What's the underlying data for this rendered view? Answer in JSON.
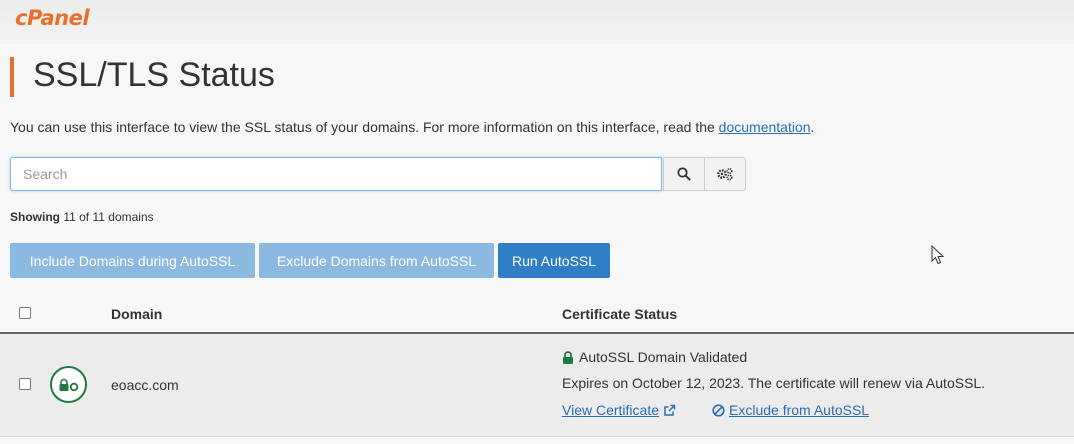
{
  "brand": {
    "logo_text": "cPanel",
    "color": "#e8702a"
  },
  "page": {
    "title": "SSL/TLS Status",
    "description_prefix": "You can use this interface to view the SSL status of your domains. For more information on this interface, read the ",
    "description_link": "documentation",
    "description_suffix": "."
  },
  "search": {
    "placeholder": "Search",
    "value": ""
  },
  "icons": {
    "search_button": "magnifier-icon",
    "settings_button": "gears-icon"
  },
  "showing": {
    "label": "Showing",
    "text": "11 of 11 domains"
  },
  "actions": {
    "include_label": "Include Domains during AutoSSL",
    "exclude_label": "Exclude Domains from AutoSSL",
    "run_label": "Run AutoSSL"
  },
  "table": {
    "columns": {
      "domain": "Domain",
      "status": "Certificate Status"
    },
    "rows": [
      {
        "domain": "eoacc.com",
        "status_title": "AutoSSL Domain Validated",
        "status_detail": "Expires on October 12, 2023. The certificate will renew via AutoSSL.",
        "view_link": "View Certificate",
        "exclude_link": "Exclude from AutoSSL",
        "status_color": "#1f7a44"
      }
    ]
  },
  "colors": {
    "accent": "#e8702a",
    "primary_button": "#2f7ec6",
    "secondary_button": "#8bb9e0",
    "link": "#2a6eb5",
    "valid": "#1f7a44"
  }
}
